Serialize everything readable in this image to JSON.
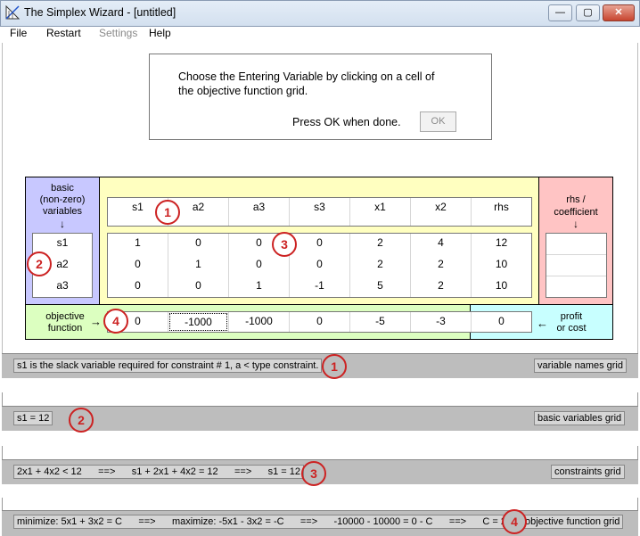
{
  "window": {
    "title": "The Simplex Wizard - [untitled]",
    "minimize": "—",
    "maximize": "▢",
    "close": "✕"
  },
  "menu": [
    "File",
    "Restart",
    "Settings",
    "Help"
  ],
  "instruction": {
    "line1": "Choose the Entering Variable  by clicking on a cell of",
    "line2": "the objective function grid.",
    "line3": "Press OK when done.",
    "ok": "OK"
  },
  "basic_panel": {
    "label1": "basic",
    "label2": "(non-zero)",
    "label3": "variables",
    "arrow": "↓"
  },
  "rhs_panel": {
    "label1": "rhs /",
    "label2": "coefficient",
    "arrow": "↓"
  },
  "objective_label": {
    "line1": "objective",
    "line2": "function",
    "arrow": "→"
  },
  "profit_label": {
    "arrow": "←",
    "line1": "profit",
    "line2": "or cost"
  },
  "variable_names": [
    "s1",
    "a2",
    "a3",
    "s3",
    "x1",
    "x2",
    "rhs"
  ],
  "basic_variables": [
    "s1",
    "a2",
    "a3"
  ],
  "constraints": [
    [
      "1",
      "0",
      "0",
      "0",
      "2",
      "4",
      "12"
    ],
    [
      "0",
      "1",
      "0",
      "0",
      "2",
      "2",
      "10"
    ],
    [
      "0",
      "0",
      "1",
      "-1",
      "5",
      "2",
      "10"
    ]
  ],
  "objective": [
    "0",
    "-1000",
    "-1000",
    "0",
    "-5",
    "-3",
    "0"
  ],
  "circles": [
    "1",
    "2",
    "3",
    "4"
  ],
  "status": [
    {
      "left": "s1 is the slack variable required for constraint # 1, a < type constraint.",
      "right": "variable names grid",
      "circle": "1"
    },
    {
      "left": "s1 = 12",
      "right": "basic variables grid",
      "circle": "2"
    },
    {
      "left": "2x1 + 4x2 < 12      ==>      s1 + 2x1 + 4x2 = 12      ==>      s1 = 12",
      "right": "constraints grid",
      "circle": "3"
    },
    {
      "left": "minimize: 5x1 + 3x2 = C      ==>      maximize: -5x1 - 3x2 = -C      ==>      -10000 - 10000 = 0 - C      ==>      C = 20000",
      "right": "objective function grid",
      "circle": "4"
    }
  ],
  "colors": {
    "accent_circle": "#cc2222"
  }
}
